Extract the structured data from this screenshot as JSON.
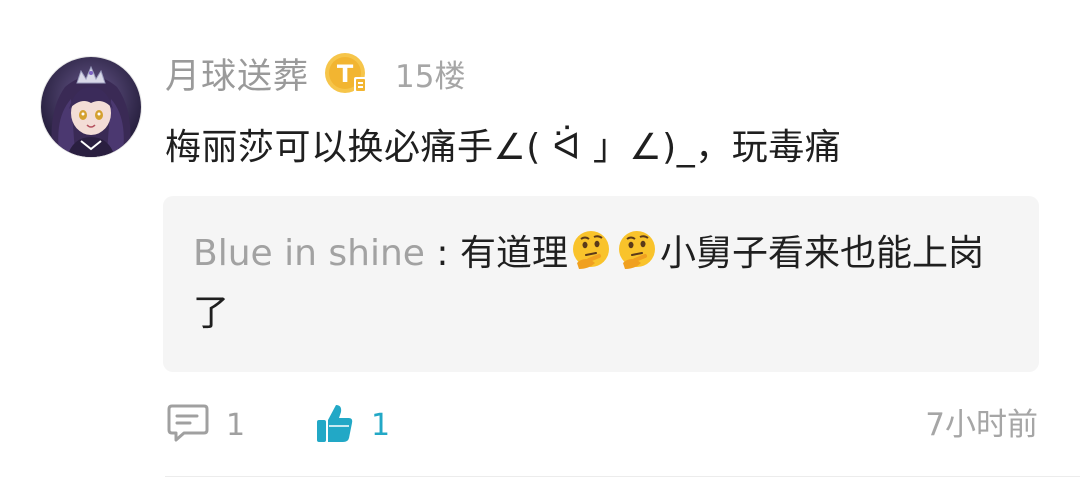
{
  "post": {
    "username": "月球送葬",
    "floor": "15楼",
    "comment": "梅丽莎可以换必痛手∠( ᐛ 」∠)_，玩毒痛"
  },
  "reply": {
    "author": "Blue in shine",
    "separator": " : ",
    "text_before_emoji": "有道理",
    "text_after_emoji": "小舅子看来也能上岗了"
  },
  "footer": {
    "reply_count": "1",
    "like_count": "1",
    "time": "7小时前"
  },
  "icons": {
    "badge": "level-badge-icon",
    "reply": "comment-bubble-icon",
    "like": "thumbs-up-icon",
    "emoji": "thinking-face-icon"
  },
  "colors": {
    "like_accent": "#22a8c6",
    "badge_gold": "#f2b531",
    "reply_bg": "#f5f5f5"
  }
}
